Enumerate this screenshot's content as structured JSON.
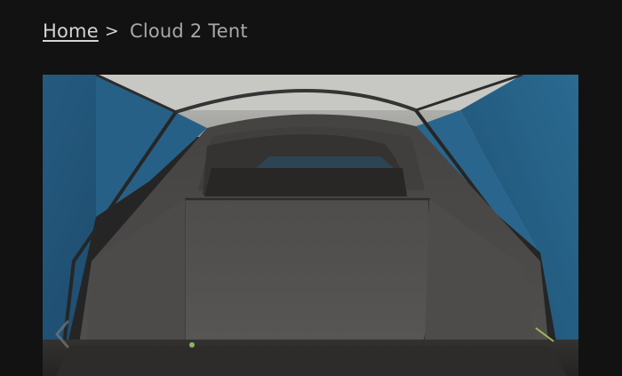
{
  "breadcrumb": {
    "home_label": "Home",
    "separator": ">",
    "current_label": "Cloud 2 Tent"
  },
  "gallery": {
    "image_subject": "tent-interior-photo",
    "prev_icon": "chevron-left-icon"
  },
  "colors": {
    "page_background": "#121212",
    "link_text": "#d4d4d4",
    "current_text": "#a8a8a8",
    "tent_blue": "#2e6f99",
    "tent_grey": "#5f5c5a"
  }
}
